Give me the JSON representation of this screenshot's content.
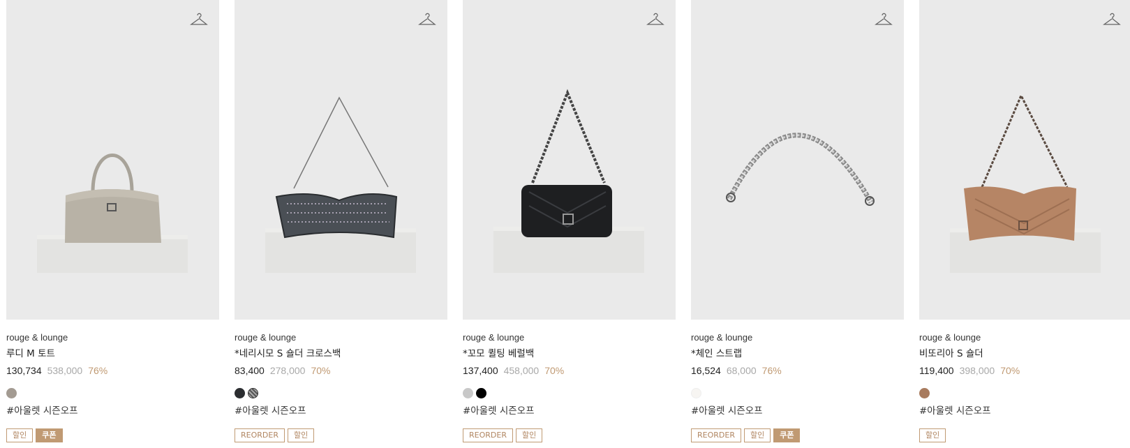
{
  "colors": {
    "accent": "#c09a73",
    "thumb_bg": "#eaeaea"
  },
  "products": [
    {
      "brand": "rouge & lounge",
      "name": "루디 M 토트",
      "price_sale": "130,734",
      "price_original": "538,000",
      "discount": "76%",
      "swatches": [
        "#a39b92"
      ],
      "hashtag": "#아울렛 시즌오프",
      "badges": [
        {
          "label": "할인",
          "filled": false
        },
        {
          "label": "쿠폰",
          "filled": true
        }
      ],
      "wishlist_icon": "hanger-icon"
    },
    {
      "brand": "rouge & lounge",
      "name": "*네리시모 S 숄더 크로스백",
      "price_sale": "83,400",
      "price_original": "278,000",
      "discount": "70%",
      "swatches": [
        "#2b2d30",
        "pattern"
      ],
      "hashtag": "#아울렛 시즌오프",
      "badges": [
        {
          "label": "REORDER",
          "filled": false
        },
        {
          "label": "할인",
          "filled": false
        }
      ],
      "wishlist_icon": "hanger-icon"
    },
    {
      "brand": "rouge & lounge",
      "name": "*꼬모 퀼팅 베럴백",
      "price_sale": "137,400",
      "price_original": "458,000",
      "discount": "70%",
      "swatches": [
        "#c8c8c8",
        "#000000"
      ],
      "hashtag": "#아울렛 시즌오프",
      "badges": [
        {
          "label": "REORDER",
          "filled": false
        },
        {
          "label": "할인",
          "filled": false
        }
      ],
      "wishlist_icon": "hanger-icon"
    },
    {
      "brand": "rouge & lounge",
      "name": "*체인 스트랩",
      "price_sale": "16,524",
      "price_original": "68,000",
      "discount": "76%",
      "swatches": [
        "#f7f5f2"
      ],
      "hashtag": "#아울렛 시즌오프",
      "badges": [
        {
          "label": "REORDER",
          "filled": false
        },
        {
          "label": "할인",
          "filled": false
        },
        {
          "label": "쿠폰",
          "filled": true
        }
      ],
      "wishlist_icon": "hanger-icon"
    },
    {
      "brand": "rouge & lounge",
      "name": "비또리아 S 숄더",
      "price_sale": "119,400",
      "price_original": "398,000",
      "discount": "70%",
      "swatches": [
        "#a87b5e"
      ],
      "hashtag": "#아울렛 시즌오프",
      "badges": [
        {
          "label": "할인",
          "filled": false
        }
      ],
      "wishlist_icon": "hanger-icon"
    }
  ]
}
